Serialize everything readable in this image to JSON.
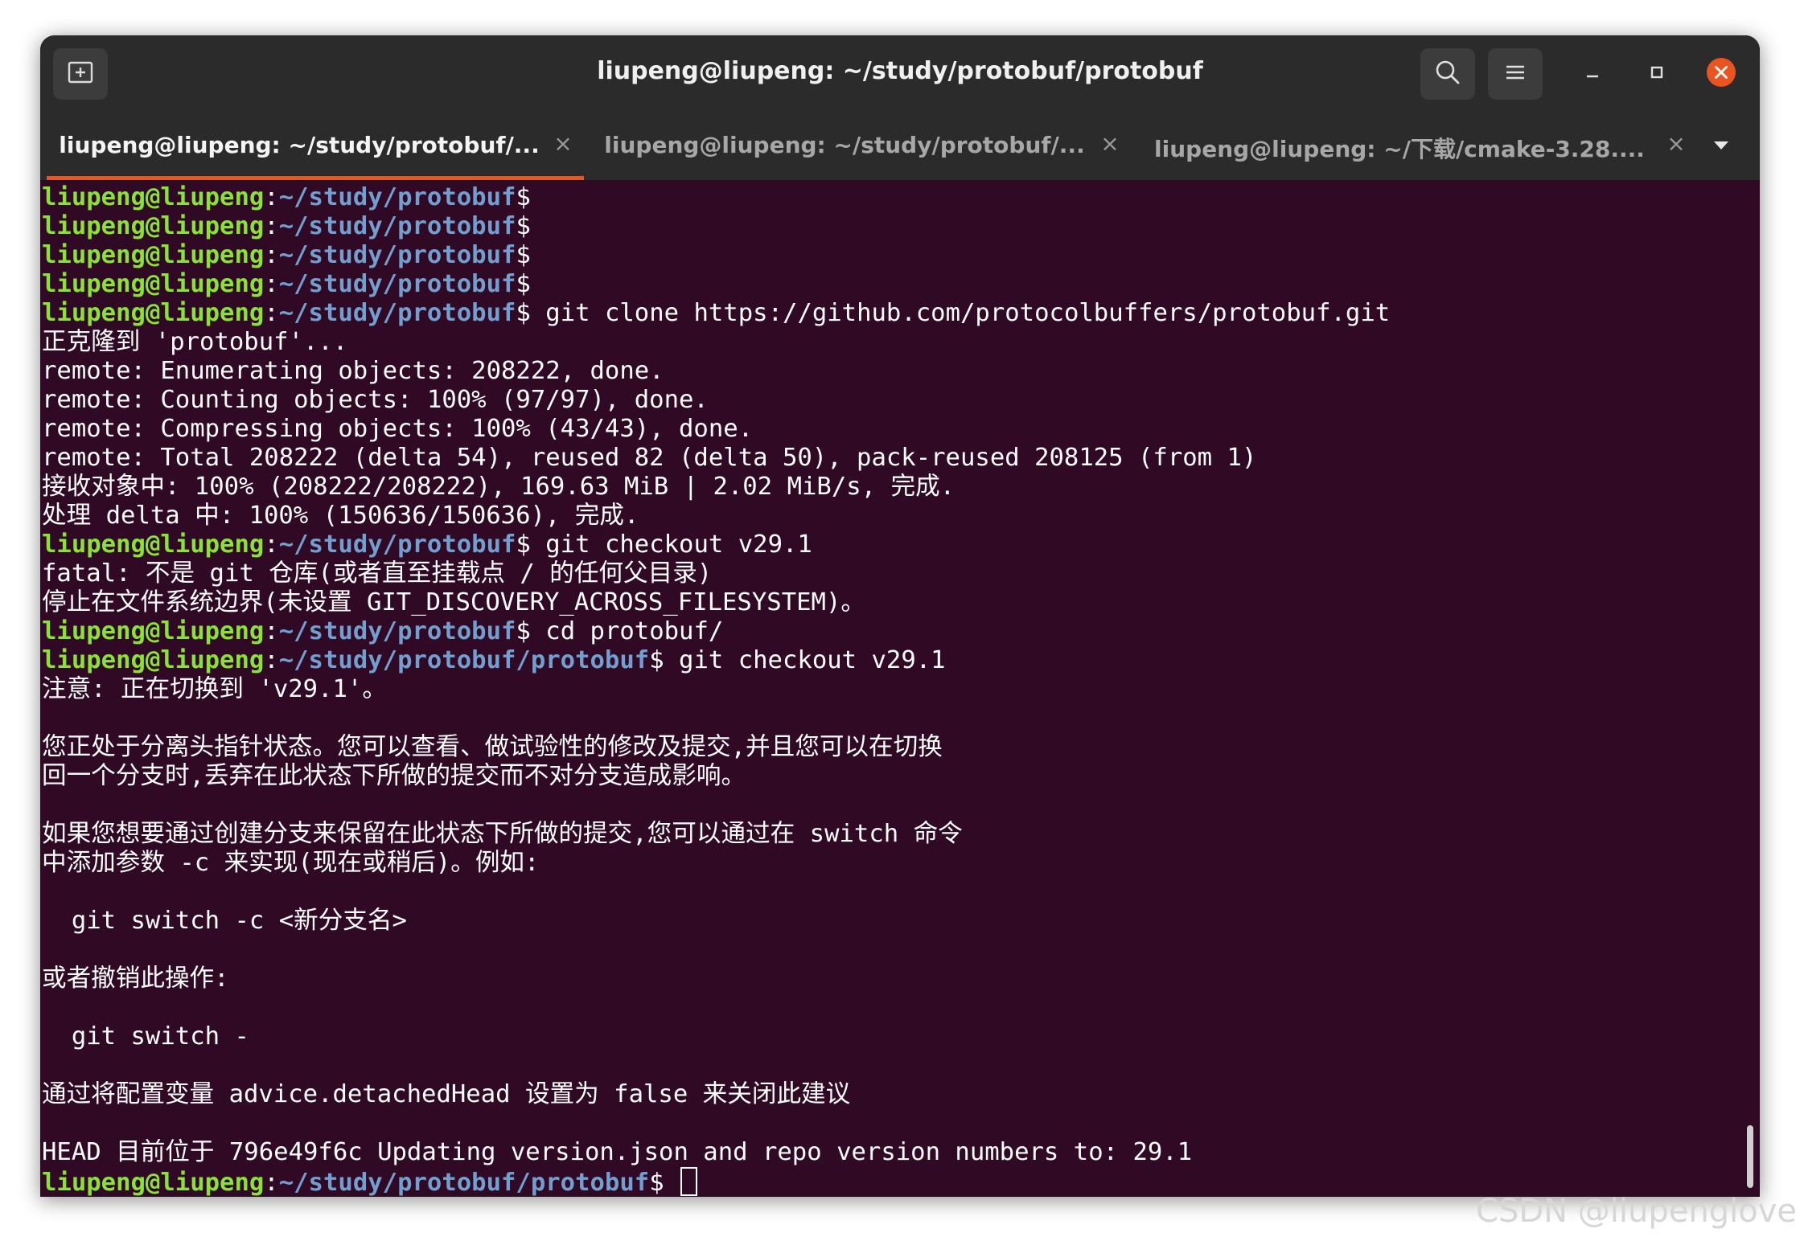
{
  "window": {
    "title": "liupeng@liupeng: ~/study/protobuf/protobuf"
  },
  "tabs": [
    {
      "label": "liupeng@liupeng: ~/study/protobuf/...",
      "active": true
    },
    {
      "label": "liupeng@liupeng: ~/study/protobuf/...",
      "active": false
    },
    {
      "label": "liupeng@liupeng: ~/下载/cmake-3.28....",
      "active": false
    }
  ],
  "tab_close_glyph": "×",
  "icons": {
    "new_tab": "new-tab-icon",
    "search": "search-icon",
    "menu": "hamburger-menu-icon",
    "minimize": "minimize-icon",
    "maximize": "maximize-icon",
    "close": "close-icon",
    "tab_list": "chevron-down-icon"
  },
  "colors": {
    "terminal_bg": "#300a24",
    "prompt_user": "#8ae234",
    "prompt_path": "#729fcf",
    "accent": "#e95420"
  },
  "terminal": {
    "prompt_user": "liupeng@liupeng",
    "lines": [
      {
        "type": "prompt",
        "path": "~/study/protobuf",
        "cmd": ""
      },
      {
        "type": "prompt",
        "path": "~/study/protobuf",
        "cmd": ""
      },
      {
        "type": "prompt",
        "path": "~/study/protobuf",
        "cmd": ""
      },
      {
        "type": "prompt",
        "path": "~/study/protobuf",
        "cmd": ""
      },
      {
        "type": "prompt",
        "path": "~/study/protobuf",
        "cmd": " git clone https://github.com/protocolbuffers/protobuf.git"
      },
      {
        "type": "output",
        "text": "正克隆到 'protobuf'..."
      },
      {
        "type": "output",
        "text": "remote: Enumerating objects: 208222, done."
      },
      {
        "type": "output",
        "text": "remote: Counting objects: 100% (97/97), done."
      },
      {
        "type": "output",
        "text": "remote: Compressing objects: 100% (43/43), done."
      },
      {
        "type": "output",
        "text": "remote: Total 208222 (delta 54), reused 82 (delta 50), pack-reused 208125 (from 1)"
      },
      {
        "type": "output",
        "text": "接收对象中: 100% (208222/208222), 169.63 MiB | 2.02 MiB/s, 完成."
      },
      {
        "type": "output",
        "text": "处理 delta 中: 100% (150636/150636), 完成."
      },
      {
        "type": "prompt",
        "path": "~/study/protobuf",
        "cmd": " git checkout v29.1"
      },
      {
        "type": "output",
        "text": "fatal: 不是 git 仓库(或者直至挂载点 / 的任何父目录)"
      },
      {
        "type": "output",
        "text": "停止在文件系统边界(未设置 GIT_DISCOVERY_ACROSS_FILESYSTEM)。"
      },
      {
        "type": "prompt",
        "path": "~/study/protobuf",
        "cmd": " cd protobuf/"
      },
      {
        "type": "prompt",
        "path": "~/study/protobuf/protobuf",
        "cmd": " git checkout v29.1"
      },
      {
        "type": "output",
        "text": "注意: 正在切换到 'v29.1'。"
      },
      {
        "type": "output",
        "text": ""
      },
      {
        "type": "output",
        "text": "您正处于分离头指针状态。您可以查看、做试验性的修改及提交,并且您可以在切换"
      },
      {
        "type": "output",
        "text": "回一个分支时,丢弃在此状态下所做的提交而不对分支造成影响。"
      },
      {
        "type": "output",
        "text": ""
      },
      {
        "type": "output",
        "text": "如果您想要通过创建分支来保留在此状态下所做的提交,您可以通过在 switch 命令"
      },
      {
        "type": "output",
        "text": "中添加参数 -c 来实现(现在或稍后)。例如:"
      },
      {
        "type": "output",
        "text": ""
      },
      {
        "type": "output",
        "text": "  git switch -c <新分支名>"
      },
      {
        "type": "output",
        "text": ""
      },
      {
        "type": "output",
        "text": "或者撤销此操作:"
      },
      {
        "type": "output",
        "text": ""
      },
      {
        "type": "output",
        "text": "  git switch -"
      },
      {
        "type": "output",
        "text": ""
      },
      {
        "type": "output",
        "text": "通过将配置变量 advice.detachedHead 设置为 false 来关闭此建议"
      },
      {
        "type": "output",
        "text": ""
      },
      {
        "type": "output",
        "text": "HEAD 目前位于 796e49f6c Updating version.json and repo version numbers to: 29.1"
      },
      {
        "type": "prompt",
        "path": "~/study/protobuf/protobuf",
        "cmd": " ",
        "cursor": true
      }
    ]
  },
  "watermark": "CSDN @liupenglove"
}
